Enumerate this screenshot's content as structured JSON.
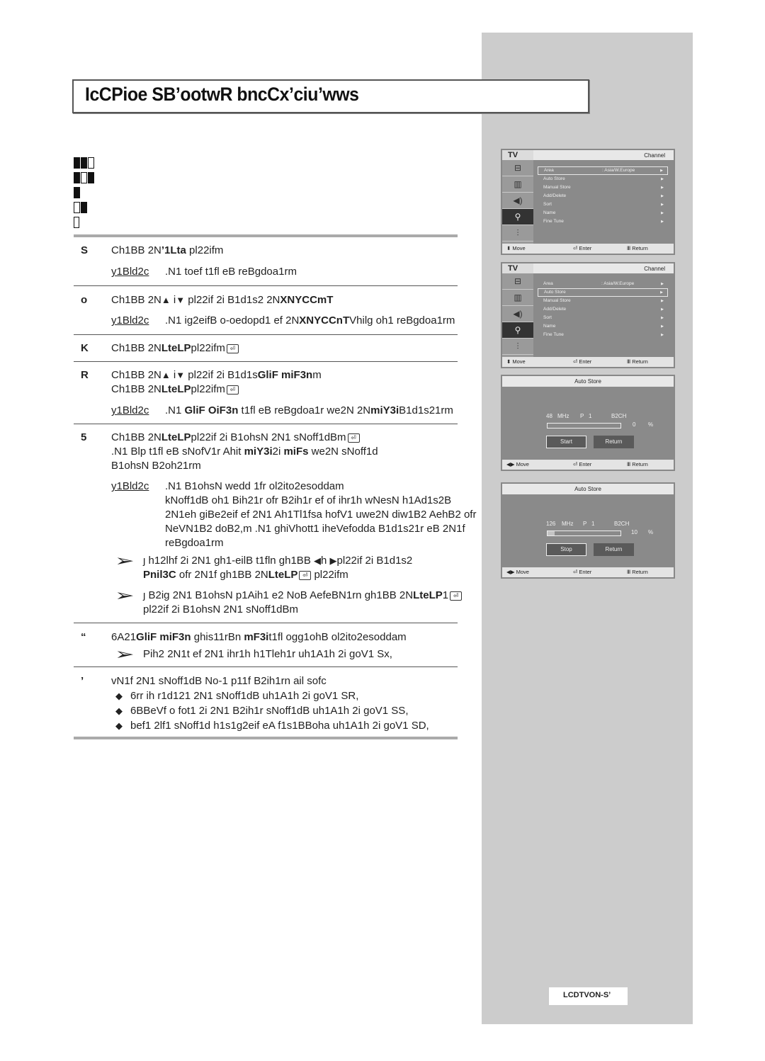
{
  "page": {
    "title": "IcCPioe SB’ootwR bncCx’ciu’wws",
    "model_badge": "LCDTVON-S’",
    "glyph_rows": [
      [
        "f",
        "f",
        "o"
      ],
      [
        "f",
        "o",
        "f"
      ],
      [
        "f"
      ],
      [
        "o",
        "f"
      ],
      [
        "h"
      ]
    ]
  },
  "steps": [
    {
      "num": "S",
      "lines": [
        {
          "pre": "Ch1BB 2N",
          "bold": "’1Lta",
          "post": "    pl22ifm"
        }
      ],
      "note": {
        "label": "y1Bld2c",
        "lines": [
          ".N1 toef t1fl eB reBgdoa1rm"
        ]
      }
    },
    {
      "num": "o",
      "lines": [
        {
          "pre": "Ch1BB 2N",
          "up": "▲",
          "mid": "   i",
          "down": "▼",
          "post": "   pl22if 2i B1d1s2 2N",
          "bold": "XNYCCmT"
        }
      ],
      "note": {
        "label": "y1Bld2c",
        "pre": ".N1 ig2eifB o-oedopd1 ef 2N",
        "bold": "XNYCCnT",
        "post": "Vhilg oh1 reBgdoa1rm"
      }
    },
    {
      "num": "K",
      "lines": [
        {
          "pre": "Ch1BB 2N",
          "bold": "LteLP",
          "enter": true,
          "post": "pl22ifm"
        }
      ]
    },
    {
      "num": "R",
      "lines": [
        {
          "pre": "Ch1BB 2N",
          "up": "▲",
          "mid": "   i",
          "down": "▼",
          "post": "   pl22if 2i B1d1s",
          "bold": "GliF miF3n",
          "tail": "m"
        },
        {
          "pre": "Ch1BB 2N",
          "bold": "LteLP",
          "enter": true,
          "post": "pl22ifm"
        }
      ],
      "note": {
        "label": "y1Bld2c",
        "pre": ".N1 ",
        "bold": "GliF OiF3n",
        "post": " t1fl eB reBgdoa1r we2N 2N",
        "bold2": "miY3i",
        "tail": "B1d1s21rm"
      }
    },
    {
      "num": "5",
      "lines": [
        {
          "pre": "Ch1BB 2N",
          "bold": "LteLP",
          "enter": true,
          "post": "pl22if 2i B1ohsN 2N1 sNoff1dBm"
        },
        {
          "pre": ".N1 Blp t1fl eB sNofV1r Ahit     ",
          "bold": "miY3i",
          "post": "2i ",
          "bold2": "miFs",
          "tail": " we2N sNoff1d"
        },
        {
          "pre": "B1ohsN B2oh21rm"
        }
      ],
      "note": {
        "label": "y1Bld2c",
        "lines": [
          ".N1 B1ohsN wedd 1fr ol2ito2esoddam",
          "kNoff1dB oh1 Bih21r ofr B2ih1r ef of ihr1h wNesN h1Ad1s2B",
          "2N1eh giBe2eif ef 2N1 Ah1Tl1fsa hofV1 uwe2N diw1B2 AehB2 ofr",
          "NeVN1B2 doB2,m .N1 ghiVhott1 iheVefodda B1d1s21r eB 2N1f",
          "reBgdoa1rm"
        ]
      },
      "tips": [
        {
          "lines": [
            {
              "pre": "ȷ h12lhf 2i 2N1 gh1-eilB t1fln gh1BB  ",
              "left": "◀",
              "mid": "h  ",
              "right": "▶",
              "post": "pl22if 2i B1d1s2"
            },
            {
              "bold": "Pnil3C",
              "post": "  ofr 2N1f gh1BB 2N",
              "bold2": "LteLP",
              "enter": true,
              "tail": "pl22ifm"
            }
          ]
        },
        {
          "lines": [
            {
              "pre": "ȷ B2ig 2N1 B1ohsN p1Aih1 e2 NoB AefeBN1rn gh1BB 2N",
              "bold": "LteLP",
              "post": "1",
              "enter": true
            },
            {
              "pre": "pl22if 2i B1ohsN 2N1 sNoff1dBm"
            }
          ]
        }
      ]
    },
    {
      "num": "“",
      "lines": [
        {
          "pre": "6A21",
          "bold": "GliF miF3n",
          "post": " ghis11rBn ",
          "bold2": "mF3i",
          "tail": "t1fl ogg1ohB ol2ito2esoddam"
        }
      ],
      "tips": [
        {
          "lines": [
            {
              "pre": "Pih2 2N1t ef 2N1 ihr1h h1Tleh1r uh1A1h 2i goV1 Sx,"
            }
          ]
        }
      ]
    },
    {
      "num": "’",
      "lines": [
        {
          "pre": "vN1f 2N1 sNoff1dB No-1 p11f B2ih1rn ail sofc"
        }
      ],
      "bullets": [
        "6rr ih r1d121 2N1 sNoff1dB uh1A1h 2i goV1 SR,",
        "6BBeVf o fot1 2i 2N1 B2ih1r sNoff1dB uh1A1h 2i goV1 SS,",
        "bef1 2lf1 sNoff1d h1s1g2eif eA f1s1BBoha uh1A1h 2i goV1 SD,"
      ]
    }
  ],
  "tv_menus": [
    {
      "label": "TV",
      "title": "Channel",
      "selected_index": 0,
      "items": [
        {
          "label": "Area",
          "value": "Asia/W.Europe"
        },
        {
          "label": "Auto Store",
          "value": ""
        },
        {
          "label": "Manual Store",
          "value": ""
        },
        {
          "label": "Add/Delete",
          "value": ""
        },
        {
          "label": "Sort",
          "value": ""
        },
        {
          "label": "Name",
          "value": ""
        },
        {
          "label": "Fine Tune",
          "value": ""
        }
      ],
      "sidebar_icons": [
        "input-icon",
        "picture-icon",
        "sound-icon",
        "channel-icon",
        "setup-icon"
      ],
      "active_icon": 3,
      "footer": {
        "move": "Move",
        "enter": "Enter",
        "return": "Return"
      }
    },
    {
      "label": "TV",
      "title": "Channel",
      "selected_index": 1,
      "items": [
        {
          "label": "Area",
          "value": "Asia/W.Europe"
        },
        {
          "label": "Auto Store",
          "value": ""
        },
        {
          "label": "Manual Store",
          "value": ""
        },
        {
          "label": "Add/Delete",
          "value": ""
        },
        {
          "label": "Sort",
          "value": ""
        },
        {
          "label": "Name",
          "value": ""
        },
        {
          "label": "Fine Tune",
          "value": ""
        }
      ],
      "sidebar_icons": [
        "input-icon",
        "picture-icon",
        "sound-icon",
        "channel-icon",
        "setup-icon"
      ],
      "active_icon": 3,
      "footer": {
        "move": "Move",
        "enter": "Enter",
        "return": "Return"
      }
    }
  ],
  "auto_store_panels": [
    {
      "title": "Auto Store",
      "freq": "48",
      "unit": "MHz",
      "prog_label": "P",
      "prog": "1",
      "system": "B2CH",
      "percent": "0",
      "percent_sign": "%",
      "progress": 0,
      "buttons": [
        "Start",
        "Return"
      ],
      "focused": 0,
      "footer": {
        "move": "Move",
        "enter": "Enter",
        "return": "Return"
      }
    },
    {
      "title": "Auto Store",
      "freq": "126",
      "unit": "MHz",
      "prog_label": "P",
      "prog": "1",
      "system": "B2CH",
      "percent": "10",
      "percent_sign": "%",
      "progress": 10,
      "buttons": [
        "Stop",
        "Return"
      ],
      "focused": 0,
      "footer": {
        "move": "Move",
        "enter": "Enter",
        "return": "Return"
      }
    }
  ],
  "icons": {
    "enter": "⏎",
    "tip_arrow": "➢",
    "bullet": "◆",
    "menu_arrow": "▶",
    "move_updown": "⬍",
    "move_leftright": "◀▶",
    "return": "Ⅲ"
  }
}
